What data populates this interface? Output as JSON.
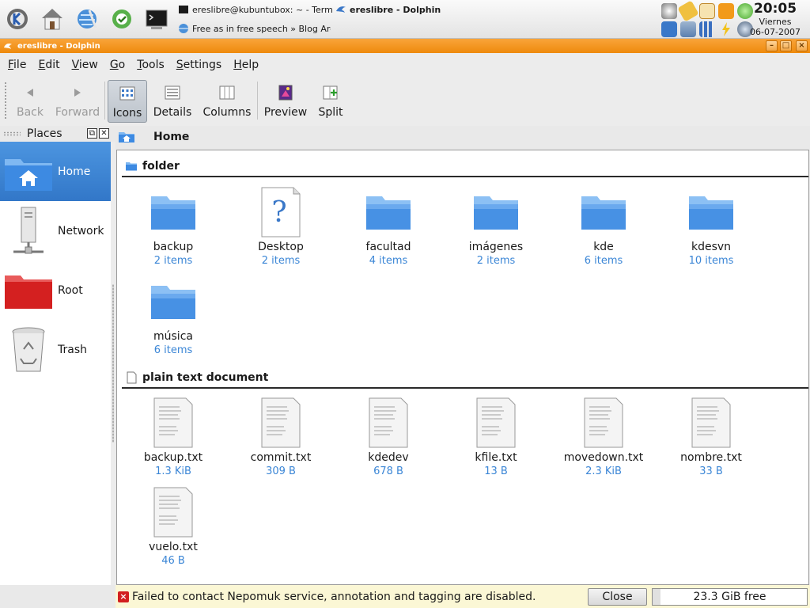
{
  "panel": {
    "launchers": [
      "kmenu-icon",
      "home-icon",
      "konqueror-icon",
      "kontact-icon",
      "terminal-icon"
    ],
    "tasks": [
      {
        "label": "ereslibre@kubuntubox: ~ - Terminal",
        "icon": "terminal-icon"
      },
      {
        "label": "ereslibre - Dolphin",
        "icon": "dolphin-icon",
        "active": true
      },
      {
        "label": "Free as in free speech » Blog Archiv",
        "icon": "browser-icon"
      }
    ],
    "tray_icons": [
      "weather-icon",
      "clipboard-icon",
      "kopete-icon",
      "akregator-icon",
      "update-icon",
      "kmix-icon",
      "network-icon",
      "signal-icon",
      "power-icon",
      "knetworkmanager-icon"
    ],
    "clock": {
      "time": "20:05",
      "day": "Viernes",
      "date": "06-07-2007"
    }
  },
  "window": {
    "title": "ereslibre - Dolphin",
    "buttons": [
      "minimize",
      "maximize",
      "close"
    ]
  },
  "menu": [
    "File",
    "Edit",
    "View",
    "Go",
    "Tools",
    "Settings",
    "Help"
  ],
  "toolbar": {
    "back": "Back",
    "forward": "Forward",
    "icons": "Icons",
    "details": "Details",
    "columns": "Columns",
    "preview": "Preview",
    "split": "Split"
  },
  "places": {
    "title": "Places",
    "items": [
      {
        "label": "Home",
        "icon": "home-folder-icon",
        "selected": true
      },
      {
        "label": "Network",
        "icon": "network-server-icon"
      },
      {
        "label": "Root",
        "icon": "red-folder-icon"
      },
      {
        "label": "Trash",
        "icon": "trash-icon"
      }
    ]
  },
  "breadcrumb": {
    "current": "Home"
  },
  "groups": [
    {
      "title": "folder",
      "items": [
        {
          "name": "backup",
          "meta": "2 items",
          "type": "folder"
        },
        {
          "name": "Desktop",
          "meta": "2 items",
          "type": "unknown"
        },
        {
          "name": "facultad",
          "meta": "4 items",
          "type": "folder"
        },
        {
          "name": "imágenes",
          "meta": "2 items",
          "type": "folder"
        },
        {
          "name": "kde",
          "meta": "6 items",
          "type": "folder"
        },
        {
          "name": "kdesvn",
          "meta": "10 items",
          "type": "folder"
        },
        {
          "name": "música",
          "meta": "6 items",
          "type": "folder"
        }
      ]
    },
    {
      "title": "plain text document",
      "items": [
        {
          "name": "backup.txt",
          "meta": "1.3 KiB",
          "type": "text"
        },
        {
          "name": "commit.txt",
          "meta": "309 B",
          "type": "text"
        },
        {
          "name": "kdedev",
          "meta": "678 B",
          "type": "text"
        },
        {
          "name": "kfile.txt",
          "meta": "13 B",
          "type": "text"
        },
        {
          "name": "movedown.txt",
          "meta": "2.3 KiB",
          "type": "text"
        },
        {
          "name": "nombre.txt",
          "meta": "33 B",
          "type": "text"
        },
        {
          "name": "vuelo.txt",
          "meta": "46 B",
          "type": "text"
        }
      ]
    }
  ],
  "status": {
    "message": "Failed to contact Nepomuk service, annotation and tagging are disabled.",
    "close_label": "Close",
    "free_space": "23.3 GiB free",
    "used_fraction": 0.05
  },
  "colors": {
    "titlebar": "#f29518",
    "selection": "#3e86d6",
    "meta_text": "#3b86d6",
    "status_bg": "#fbf7d5"
  }
}
